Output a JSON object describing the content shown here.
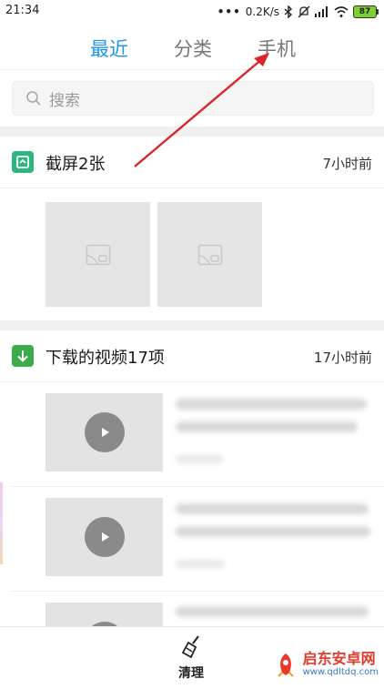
{
  "status_bar": {
    "time": "21:34",
    "network_speed": "0.2K/s",
    "battery_level": "87"
  },
  "tabs": [
    {
      "label": "最近",
      "active": true
    },
    {
      "label": "分类",
      "active": false
    },
    {
      "label": "手机",
      "active": false
    }
  ],
  "search": {
    "placeholder": "搜索"
  },
  "screenshots_section": {
    "title": "截屏2张",
    "time": "7小时前",
    "icon": "screenshot-icon"
  },
  "videos_section": {
    "title": "下载的视频17项",
    "time": "17小时前",
    "icon": "download-icon"
  },
  "bottom_bar": {
    "clean_label": "清理",
    "icon": "broom-icon"
  },
  "watermark": {
    "main": "启东安卓网",
    "sub": "www.qdltdq.com"
  },
  "colors": {
    "active_tab": "#1f96e8",
    "inactive_tab": "#777777",
    "screenshot_icon_bg": "#2db67d",
    "download_icon_bg": "#3cab4a",
    "annotation_arrow": "#d9262b"
  }
}
